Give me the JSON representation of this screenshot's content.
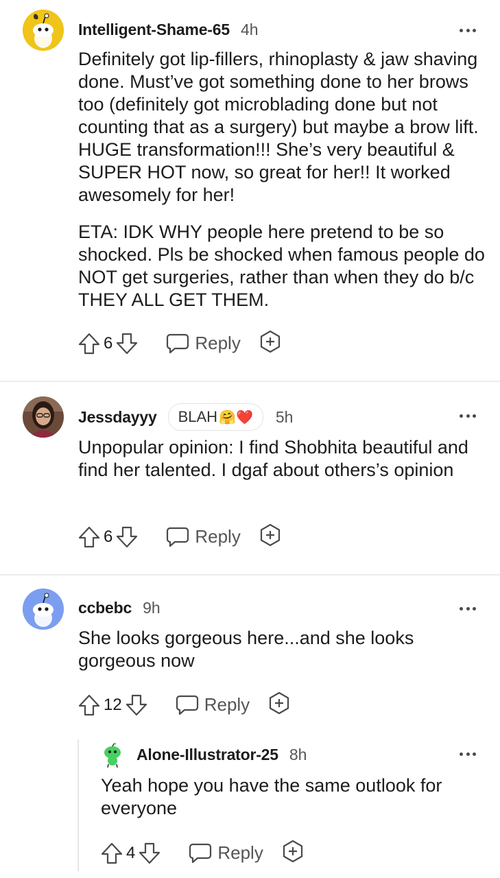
{
  "comments": [
    {
      "username": "Intelligent-Shame-65",
      "time": "4h",
      "avatar_color": "#f0c419",
      "paragraphs": [
        "Definitely got lip-fillers, rhinoplasty & jaw shaving done. Must’ve got something done to her brows too (definitely got microblading done but not counting that as a surgery) but maybe a brow lift. HUGE transformation!!! She’s very beautiful & SUPER HOT now, so great for her!! It worked awesomely for her!",
        "ETA: IDK WHY people here pretend to be so shocked. Pls be shocked when famous people do NOT get surgeries, rather than when they do b/c THEY ALL GET THEM."
      ],
      "score": "6",
      "reply_label": "Reply"
    },
    {
      "username": "Jessdayyy",
      "flair_text": "BLAH",
      "flair_emoji": "🤗❤️",
      "time": "5h",
      "paragraphs": [
        "Unpopular opinion: I find Shobhita beautiful and find her talented. I dgaf about others’s opinion"
      ],
      "score": "6",
      "reply_label": "Reply"
    },
    {
      "username": "ccbebc",
      "time": "9h",
      "avatar_color": "#7c9ef0",
      "paragraphs": [
        "She looks gorgeous here...and she looks gorgeous now"
      ],
      "score": "12",
      "reply_label": "Reply"
    },
    {
      "username": "Alone-Illustrator-25",
      "time": "8h",
      "avatar_color": "#46d160",
      "paragraphs": [
        "Yeah hope you have the same outlook for everyone"
      ],
      "score": "4",
      "reply_label": "Reply"
    }
  ]
}
